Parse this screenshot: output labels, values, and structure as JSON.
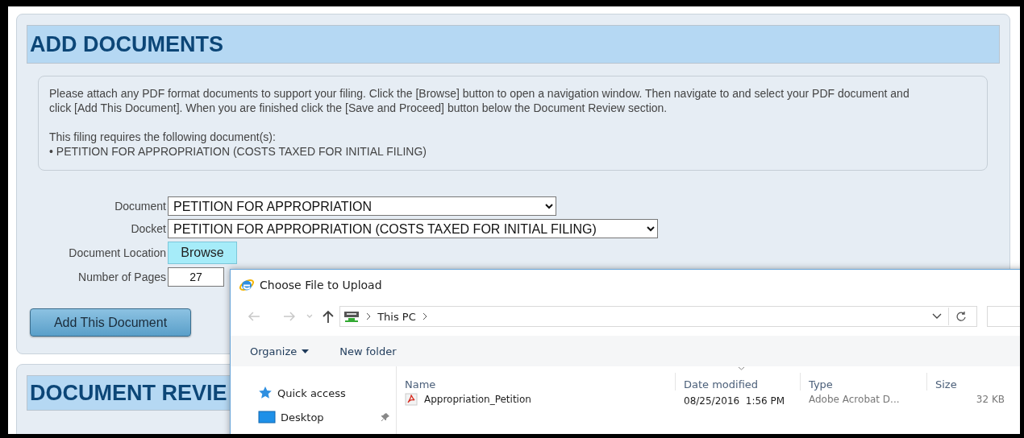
{
  "add_documents": {
    "title": "ADD DOCUMENTS",
    "instructions": "Please attach any PDF format documents to support your filing. Click the [Browse] button to open a navigation window. Then navigate to and select your PDF document and click [Add This Document]. When you are finished click the [Save and Proceed] button below the Document Review section.",
    "requirements_heading": "This filing requires the following document(s):",
    "requirements": [
      "• PETITION FOR APPROPRIATION (COSTS TAXED FOR INITIAL FILING)"
    ],
    "fields": [
      {
        "kind": "select",
        "label": "Document",
        "value": "PETITION FOR APPROPRIATION"
      },
      {
        "kind": "select",
        "label": "Docket",
        "value": "PETITION FOR APPROPRIATION (COSTS TAXED FOR INITIAL FILING)"
      },
      {
        "kind": "button",
        "label": "Document Location",
        "value": "Browse"
      },
      {
        "kind": "input",
        "label": "Number of Pages",
        "value": "27"
      }
    ],
    "add_button": "Add This Document"
  },
  "document_review": {
    "title": "DOCUMENT REVIE"
  },
  "file_dialog": {
    "title": "Choose File to Upload",
    "address": "This PC",
    "toolbar": [
      {
        "label": "Organize",
        "kind": "menu"
      },
      {
        "label": "New folder",
        "kind": "plain"
      }
    ],
    "nav_items": [
      {
        "label": "Quick access",
        "kind": "quick-access",
        "pinned": false
      },
      {
        "label": "Desktop",
        "kind": "desktop",
        "pinned": true
      }
    ],
    "columns": [
      {
        "label": "Name",
        "sorted": false
      },
      {
        "label": "Date modified",
        "sorted": true
      },
      {
        "label": "Type",
        "sorted": false
      },
      {
        "label": "Size",
        "sorted": false
      }
    ],
    "files": [
      {
        "name": "Appropriation_Petition",
        "date": "08/25/2016  1:56 PM",
        "type": "Adobe Acrobat D...",
        "size": "32 KB"
      }
    ]
  }
}
